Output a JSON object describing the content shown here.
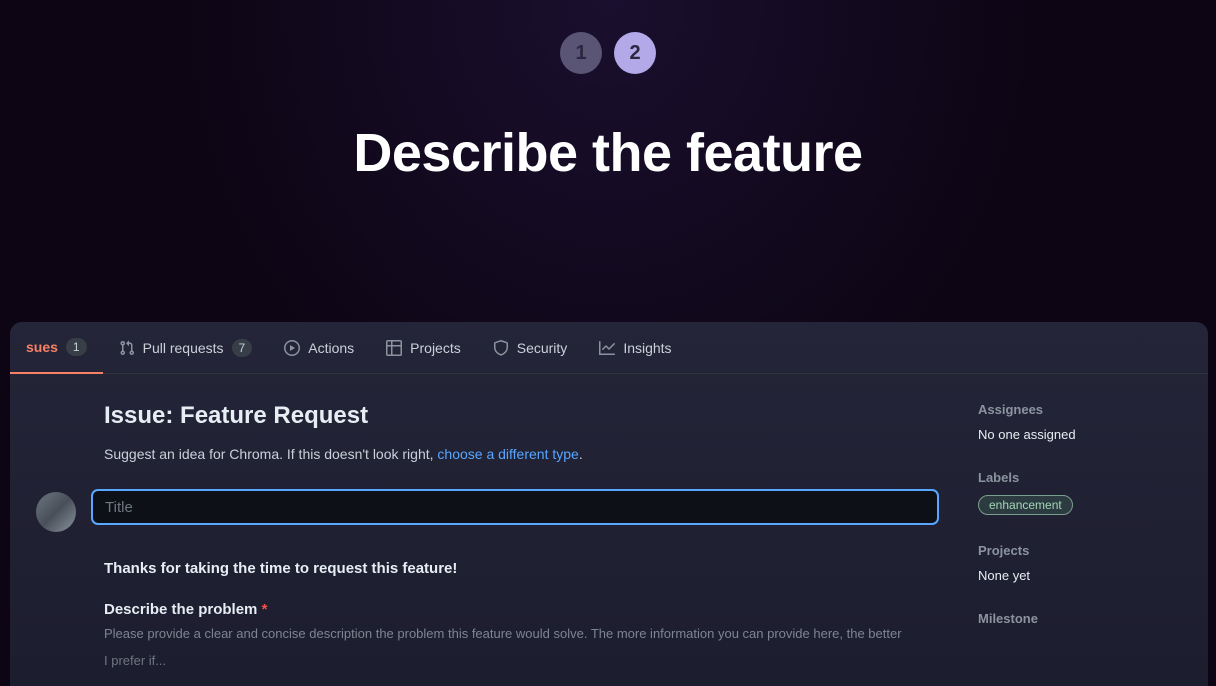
{
  "hero": {
    "steps": [
      "1",
      "2"
    ],
    "title": "Describe the feature"
  },
  "tabs": {
    "issues": {
      "label": "sues",
      "count": "1"
    },
    "pullrequests": {
      "label": "Pull requests",
      "count": "7"
    },
    "actions": {
      "label": "Actions"
    },
    "projects": {
      "label": "Projects"
    },
    "security": {
      "label": "Security"
    },
    "insights": {
      "label": "Insights"
    }
  },
  "issue": {
    "heading": "Issue: Feature Request",
    "subtitle_prefix": "Suggest an idea for Chroma. If this doesn't look right, ",
    "subtitle_link": "choose a different type",
    "subtitle_suffix": ".",
    "title_placeholder": "Title",
    "thanks": "Thanks for taking the time to request this feature!",
    "problem_label": "Describe the problem",
    "required": "*",
    "problem_help": "Please provide a clear and concise description the problem this feature would solve. The more information you can provide here, the better",
    "problem_body": "I prefer if..."
  },
  "sidebar": {
    "assignees": {
      "heading": "Assignees",
      "value": "No one assigned"
    },
    "labels": {
      "heading": "Labels",
      "badge": "enhancement"
    },
    "projects": {
      "heading": "Projects",
      "value": "None yet"
    },
    "milestone": {
      "heading": "Milestone"
    }
  }
}
